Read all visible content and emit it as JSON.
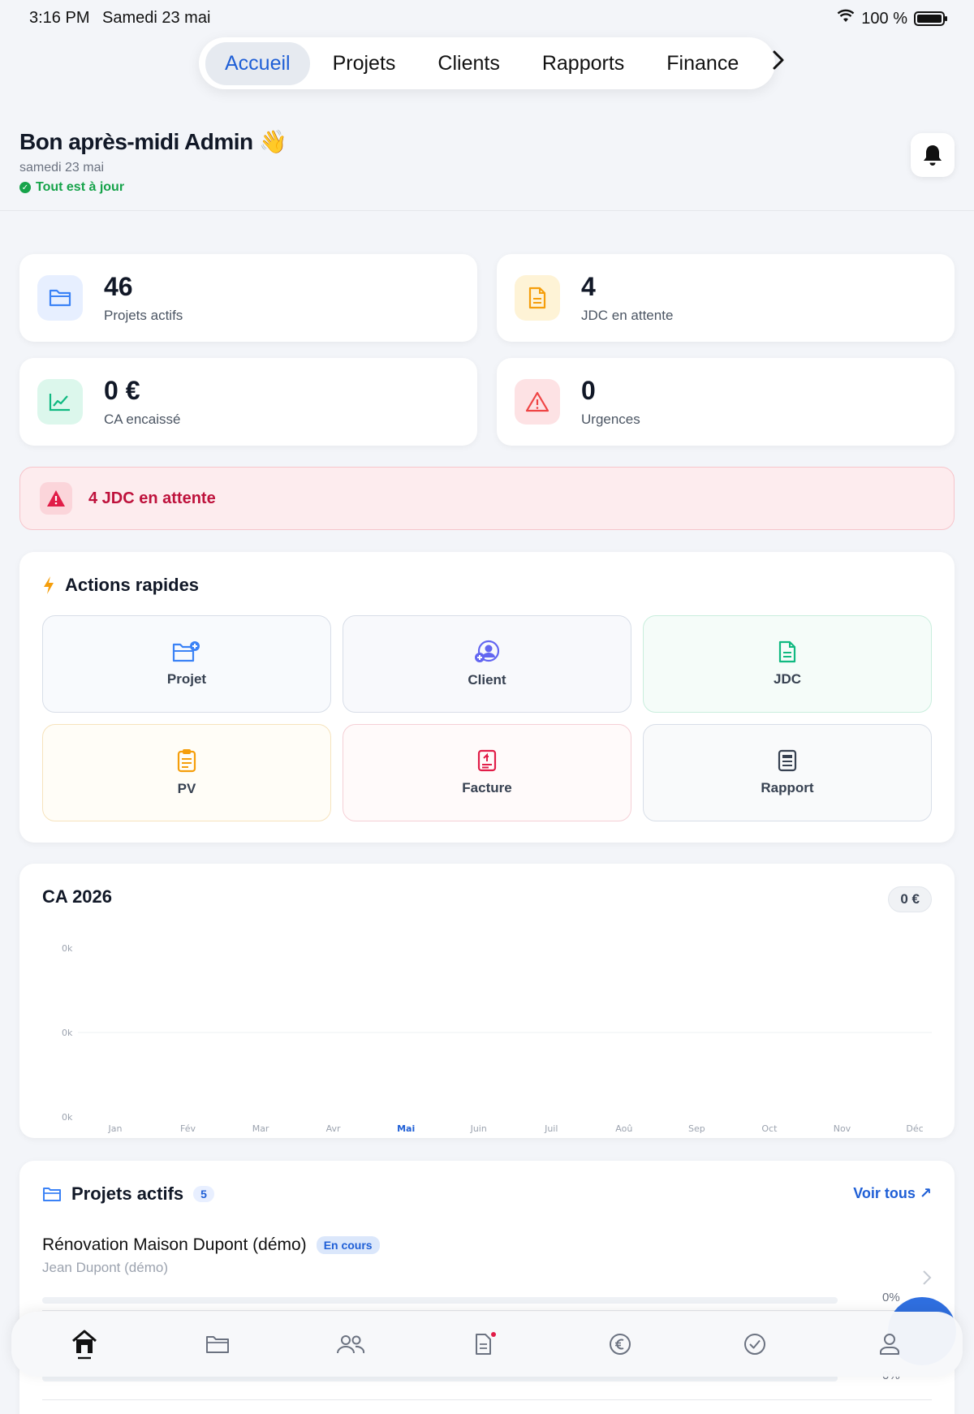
{
  "status_bar": {
    "time": "3:16 PM",
    "date": "Samedi 23 mai",
    "battery": "100 %"
  },
  "nav": {
    "tabs": [
      "Accueil",
      "Projets",
      "Clients",
      "Rapports",
      "Finance"
    ],
    "active": "Accueil"
  },
  "header": {
    "greeting": "Bon après-midi Admin",
    "emoji": "👋",
    "date": "samedi 23 mai",
    "sync_status": "Tout est à jour"
  },
  "stats": [
    {
      "value": "46",
      "label": "Projets actifs",
      "icon": "folder-icon",
      "color": "#3b82f6"
    },
    {
      "value": "4",
      "label": "JDC en attente",
      "icon": "document-icon",
      "color": "#f59e0b"
    },
    {
      "value": "0 €",
      "label": "CA encaissé",
      "icon": "trend-chart-icon",
      "color": "#10b981"
    },
    {
      "value": "0",
      "label": "Urgences",
      "icon": "warning-icon",
      "color": "#ef4444"
    }
  ],
  "alert": {
    "text": "4 JDC en attente",
    "color": "#be123c"
  },
  "quick_actions": {
    "title": "Actions rapides",
    "items": [
      {
        "label": "Projet",
        "icon": "folder-plus-icon",
        "color": "#3b82f6"
      },
      {
        "label": "Client",
        "icon": "user-plus-icon",
        "color": "#6366f1"
      },
      {
        "label": "JDC",
        "icon": "document-icon",
        "color": "#10b981"
      },
      {
        "label": "PV",
        "icon": "clipboard-icon",
        "color": "#f59e0b"
      },
      {
        "label": "Facture",
        "icon": "invoice-icon",
        "color": "#e11d48"
      },
      {
        "label": "Rapport",
        "icon": "report-icon",
        "color": "#374151"
      }
    ]
  },
  "revenue_chart": {
    "title": "CA 2026",
    "total": "0 €",
    "chart_data": {
      "type": "line",
      "title": "CA 2026",
      "categories": [
        "Jan",
        "Fév",
        "Mar",
        "Avr",
        "Mai",
        "Juin",
        "Juil",
        "Aoû",
        "Sep",
        "Oct",
        "Nov",
        "Déc"
      ],
      "series": [
        {
          "values": [
            0,
            0,
            0,
            0,
            0,
            0,
            0,
            0,
            0,
            0,
            0,
            0
          ]
        }
      ],
      "y_tick_labels": [
        "0k",
        "0k",
        "0k"
      ],
      "highlighted_category": "Mai",
      "grid": true
    }
  },
  "projects": {
    "title": "Projets actifs",
    "count": "5",
    "see_all": "Voir tous ↗",
    "items": [
      {
        "name": "Rénovation Maison Dupont (démo)",
        "status": "En cours",
        "client": "Jean Dupont (démo)",
        "progress": "0%",
        "progress_value": 0
      },
      {
        "progress": "0%",
        "progress_value": 0
      }
    ]
  },
  "tab_bar": [
    "home-icon",
    "folder-icon",
    "users-icon",
    "document-icon",
    "euro-icon",
    "check-circle-icon",
    "user-icon"
  ]
}
